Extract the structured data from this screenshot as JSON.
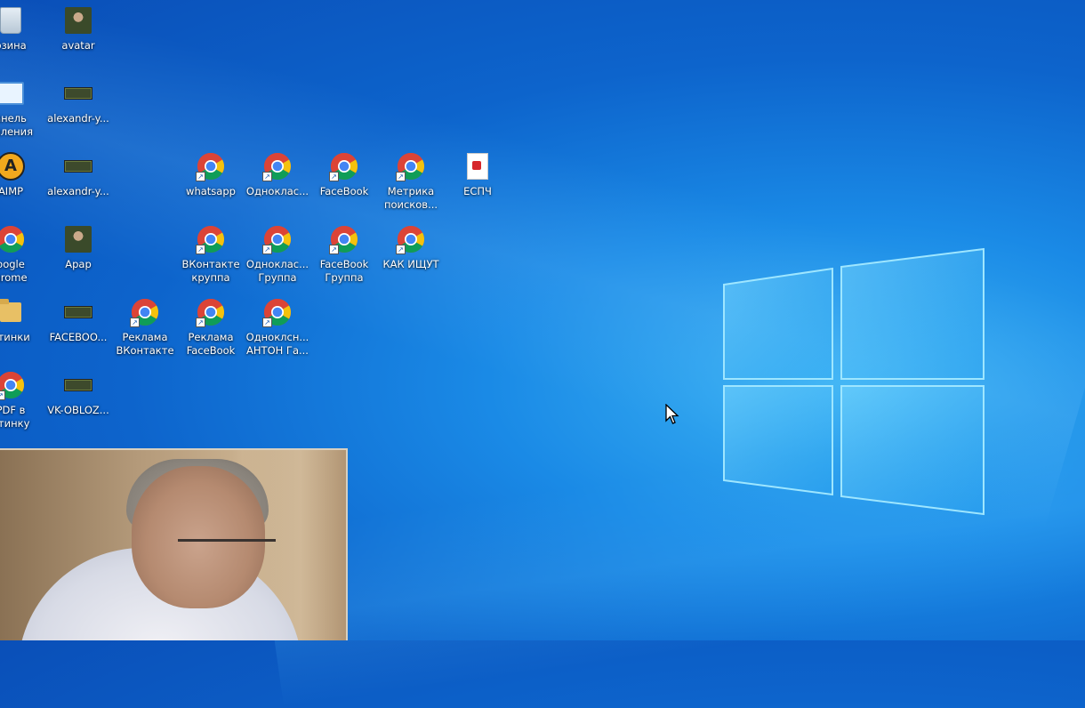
{
  "desktop": {
    "icons": [
      {
        "id": "recycle",
        "label": "рзина",
        "type": "recycle"
      },
      {
        "id": "avatar",
        "label": "avatar",
        "type": "photo"
      },
      {
        "id": "control-panel",
        "label": "анель\nавления",
        "type": "control-panel"
      },
      {
        "id": "alexandr-1",
        "label": "alexandr-y...",
        "type": "thumb"
      },
      {
        "id": "aimp",
        "label": "AIMP",
        "type": "aimp"
      },
      {
        "id": "alexandr-2",
        "label": "alexandr-y...",
        "type": "thumb"
      },
      {
        "id": "whatsapp",
        "label": "whatsapp",
        "type": "chrome",
        "shortcut": true
      },
      {
        "id": "odnoklassniki",
        "label": "Одноклас...",
        "type": "chrome",
        "shortcut": true
      },
      {
        "id": "facebook",
        "label": "FaceBook",
        "type": "chrome",
        "shortcut": true
      },
      {
        "id": "metrika",
        "label": "Метрика\nпоисков...",
        "type": "chrome",
        "shortcut": true
      },
      {
        "id": "espch",
        "label": "ЕСПЧ",
        "type": "pdf"
      },
      {
        "id": "google-chrome",
        "label": "oogle\nhrome",
        "type": "chrome"
      },
      {
        "id": "arar",
        "label": "Арар",
        "type": "photo"
      },
      {
        "id": "vk-group",
        "label": "ВКонтакте\nкруппа",
        "type": "chrome",
        "shortcut": true
      },
      {
        "id": "ok-group",
        "label": "Одноклас...\nГруппа",
        "type": "chrome",
        "shortcut": true
      },
      {
        "id": "fb-group",
        "label": "FaceBook\nГруппа",
        "type": "chrome",
        "shortcut": true
      },
      {
        "id": "kak-ishchut",
        "label": "КАК ИЩУТ",
        "type": "chrome",
        "shortcut": true
      },
      {
        "id": "kartinki",
        "label": "ртинки",
        "type": "folder"
      },
      {
        "id": "facebook-file",
        "label": "FACEBOO...",
        "type": "thumb"
      },
      {
        "id": "ad-vk",
        "label": "Реклама\nВКонтакте",
        "type": "chrome",
        "shortcut": true
      },
      {
        "id": "ad-fb",
        "label": "Реклама\nFaceBook",
        "type": "chrome",
        "shortcut": true
      },
      {
        "id": "ok-anton",
        "label": "Одноклсн...\nАНТОН Га...",
        "type": "chrome",
        "shortcut": true
      },
      {
        "id": "pdf-to-image",
        "label": "PDF в\nртинку",
        "type": "chrome",
        "shortcut": true
      },
      {
        "id": "vk-oblozhka",
        "label": "VK-OBLOZ...",
        "type": "thumb"
      }
    ]
  },
  "colors": {
    "chrome_red": "#db4437",
    "chrome_yellow": "#f4c20d",
    "chrome_green": "#0f9d58",
    "chrome_blue": "#4285f4",
    "logo_glow": "#6fd3ff"
  }
}
